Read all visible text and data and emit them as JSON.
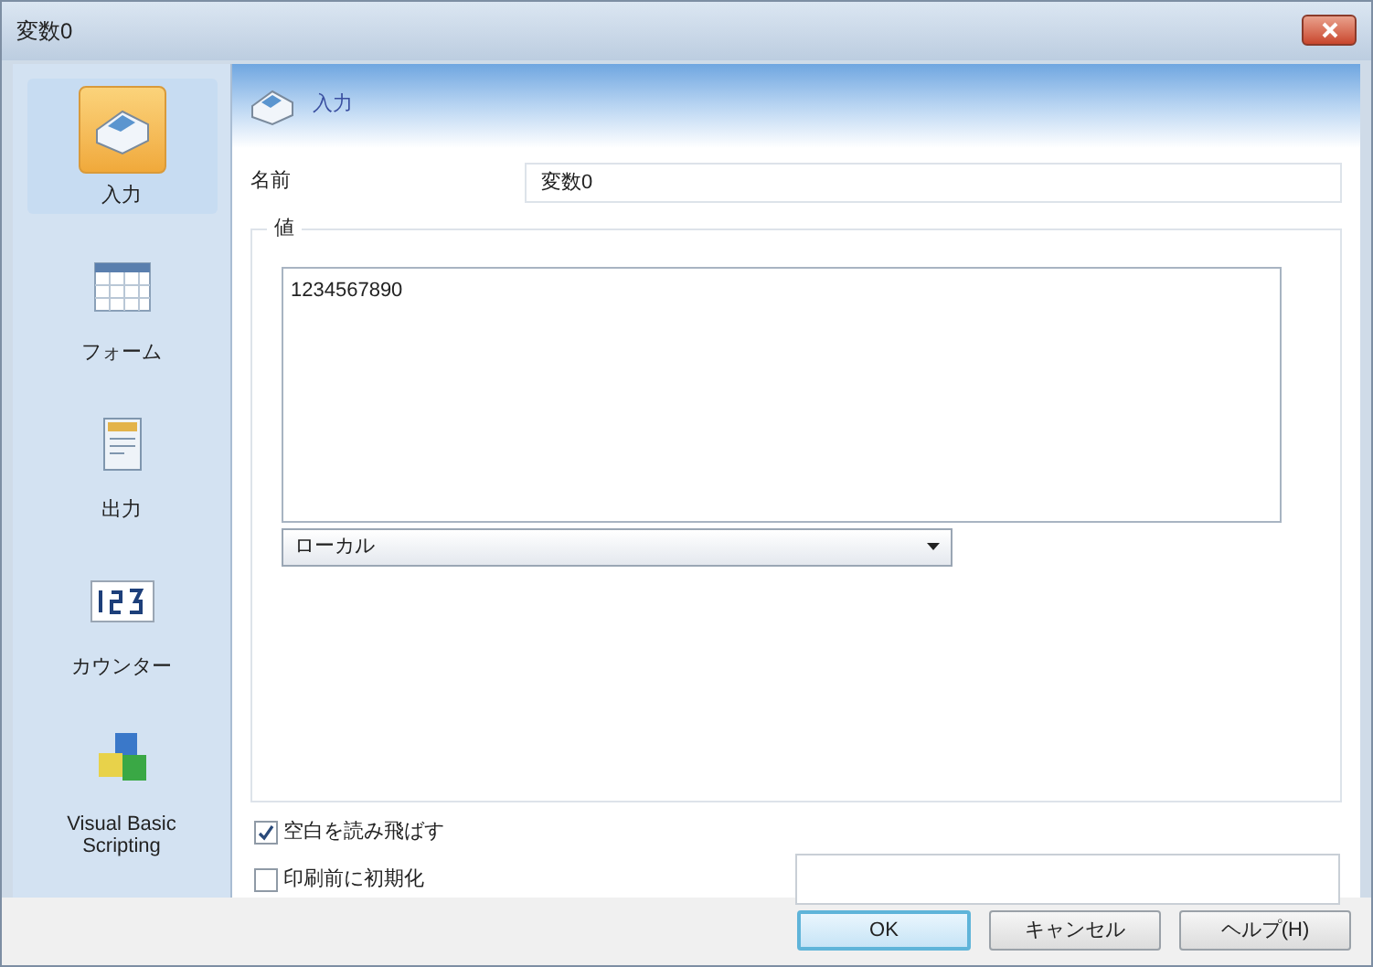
{
  "window": {
    "title": "変数0"
  },
  "sidebar": {
    "items": [
      {
        "label": "入力",
        "kind": "input",
        "selected": true
      },
      {
        "label": "フォーム",
        "kind": "form",
        "selected": false
      },
      {
        "label": "出力",
        "kind": "output",
        "selected": false
      },
      {
        "label": "カウンター",
        "kind": "counter",
        "selected": false
      },
      {
        "label": "Visual Basic Scripting",
        "kind": "script",
        "selected": false
      }
    ]
  },
  "header": {
    "title": "入力"
  },
  "name_field": {
    "label": "名前",
    "value": "変数0"
  },
  "value_group": {
    "label": "値",
    "text": "1234567890",
    "dropdown": "ローカル"
  },
  "options": [
    {
      "label": "空白を読み飛ばす",
      "checked": true
    },
    {
      "label": "印刷前に初期化",
      "checked": false
    }
  ],
  "buttons": [
    {
      "label": "OK",
      "default": true
    },
    {
      "label": "キャンセル",
      "default": false
    },
    {
      "label": "ヘルプ(H)",
      "default": false
    }
  ]
}
